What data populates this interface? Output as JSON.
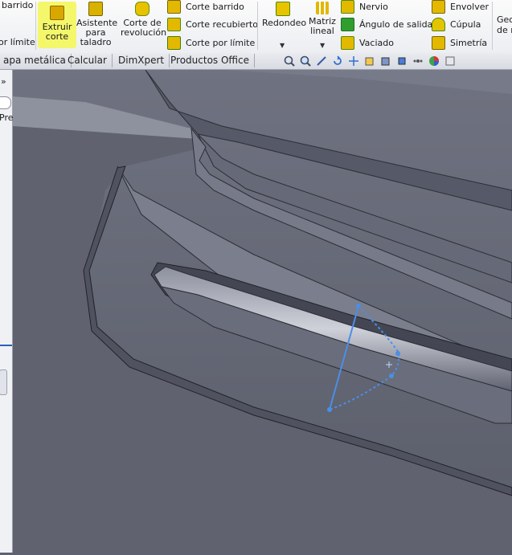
{
  "ribbon": {
    "left_cut": {
      "line1": "barrido",
      "line2": "or límite"
    },
    "extrude_cut": {
      "line1": "Extruir",
      "line2": "corte"
    },
    "hole_wizard": {
      "line1": "Asistente",
      "line2": "para",
      "line3": "taladro"
    },
    "revolve_cut": {
      "line1": "Corte de",
      "line2": "revolución"
    },
    "swept_cut": "Corte barrido",
    "lofted_cut": "Corte recubierto",
    "boundary_cut": "Corte por límite",
    "fillet": "Redondeo",
    "linear_pattern": {
      "line1": "Matriz",
      "line2": "lineal"
    },
    "rib": "Nervio",
    "draft": "Ángulo de salida",
    "shell": "Vaciado",
    "wrap": "Envolver",
    "dome": "Cúpula",
    "mirror": "Simetría",
    "right_cut": {
      "line1": "Geo",
      "line2": "de r"
    }
  },
  "tabs": [
    "apa metálica",
    "Calcular",
    "DimXpert",
    "Productos Office"
  ],
  "left_panel": {
    "expand": "»",
    "label": "Pre"
  },
  "colors": {
    "highlight": "#f4f76a",
    "sketch": "#4a8fe6",
    "body": "#6d707c"
  }
}
